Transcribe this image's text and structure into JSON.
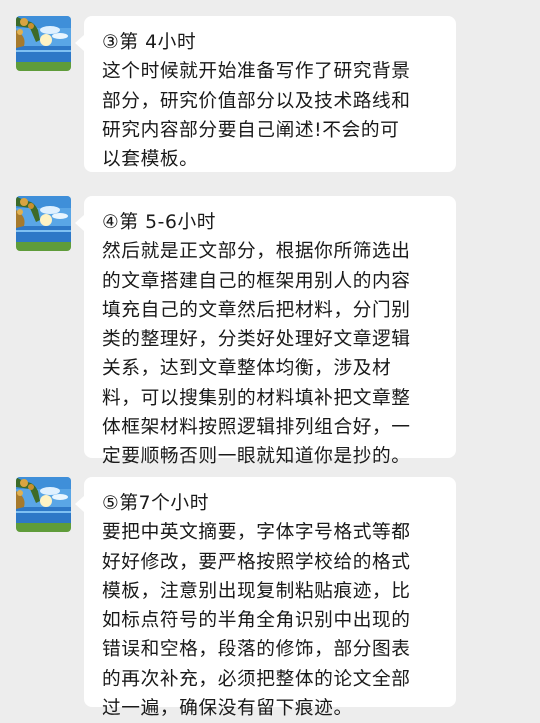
{
  "messages": [
    {
      "avatar_icon": "lake-sky-tree-avatar-icon",
      "lines": [
        "③第 4小时",
        "这个时候就开始准备写作了研究背景",
        "部分，研究价值部分以及技术路线和",
        "研究内容部分要自己阐述!不会的可",
        "以套模板。"
      ]
    },
    {
      "avatar_icon": "lake-sky-tree-avatar-icon",
      "lines": [
        "④第 5-6小时",
        "然后就是正文部分，根据你所筛选出",
        "的文章搭建自己的框架用别人的内容",
        "填充自己的文章然后把材料，分门别",
        "类的整理好，分类好处理好文章逻辑",
        "关系，达到文章整体均衡，涉及材",
        "料，可以搜集别的材料填补把文章整",
        "体框架材料按照逻辑排列组合好，一",
        "定要顺畅否则一眼就知道你是抄的。"
      ]
    },
    {
      "avatar_icon": "lake-sky-tree-avatar-icon",
      "lines": [
        "⑤第7个小时",
        "要把中英文摘要，字体字号格式等都",
        "好好修改，要严格按照学校给的格式",
        "模板，注意别出现复制粘贴痕迹，比",
        "如标点符号的半角全角识别中出现的",
        "错误和空格，段落的修饰，部分图表",
        "的再次补充，必须把整体的论文全部",
        "过一遍，确保没有留下痕迹。"
      ]
    }
  ]
}
